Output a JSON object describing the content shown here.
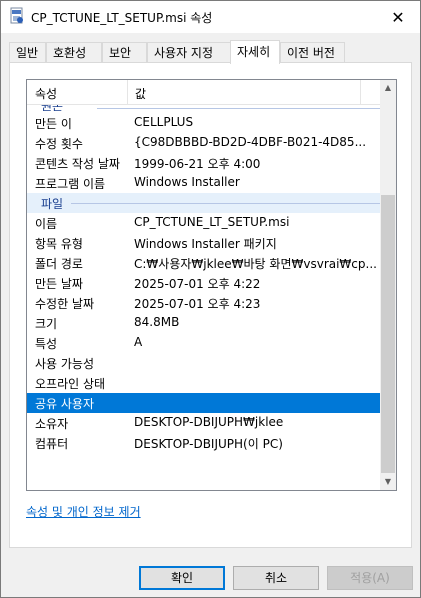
{
  "window": {
    "title": "CP_TCTUNE_LT_SETUP.msi 속성",
    "close_glyph": "✕",
    "icon": "msi-file-icon"
  },
  "tabs": [
    {
      "label": "일반",
      "active": false
    },
    {
      "label": "호환성",
      "active": false
    },
    {
      "label": "보안",
      "active": false
    },
    {
      "label": "사용자 지정",
      "active": false
    },
    {
      "label": "자세히",
      "active": true
    },
    {
      "label": "이전 버전",
      "active": false
    }
  ],
  "list": {
    "header": {
      "property": "속성",
      "value": "값"
    },
    "cut_group": "원본",
    "rows_top": [
      {
        "k": "만든 이",
        "v": "CELLPLUS"
      },
      {
        "k": "수정 횟수",
        "v": "{C98DBBBD-BD2D-4DBF-B021-4D85..."
      },
      {
        "k": "콘텐츠 작성 날짜",
        "v": "1999-06-21 오후 4:00"
      },
      {
        "k": "프로그램 이름",
        "v": "Windows Installer"
      }
    ],
    "group_file": "파일",
    "rows_file": [
      {
        "k": "이름",
        "v": "CP_TCTUNE_LT_SETUP.msi"
      },
      {
        "k": "항목 유형",
        "v": "Windows Installer 패키지"
      },
      {
        "k": "폴더 경로",
        "v": "C:₩사용자₩jklee₩바탕 화면₩vsvrai₩cp..."
      },
      {
        "k": "만든 날짜",
        "v": "2025-07-01 오후 4:22"
      },
      {
        "k": "수정한 날짜",
        "v": "2025-07-01 오후 4:23"
      },
      {
        "k": "크기",
        "v": "84.8MB"
      },
      {
        "k": "특성",
        "v": "A"
      },
      {
        "k": "사용 가능성",
        "v": ""
      },
      {
        "k": "오프라인 상태",
        "v": ""
      },
      {
        "k": "공유 사용자",
        "v": "",
        "selected": true
      },
      {
        "k": "소유자",
        "v": "DESKTOP-DBIJUPH₩jklee"
      },
      {
        "k": "컴퓨터",
        "v": "DESKTOP-DBIJUPH(이 PC)"
      }
    ]
  },
  "link": "속성 및 개인 정보 제거",
  "buttons": {
    "ok": "확인",
    "cancel": "취소",
    "apply": "적용(A)"
  }
}
